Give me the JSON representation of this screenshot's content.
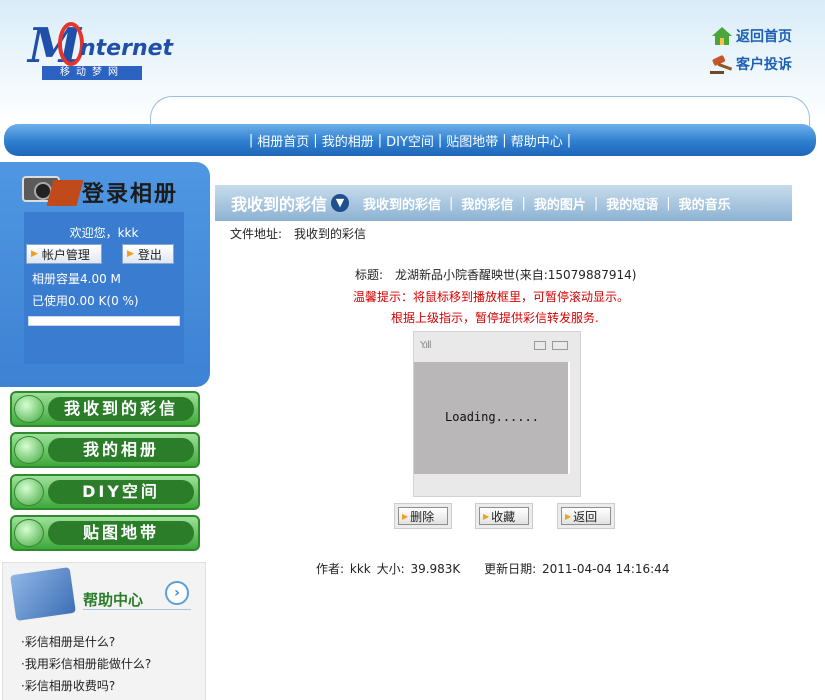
{
  "header": {
    "logo": {
      "mark": "M",
      "text": "nternet",
      "subtitle": "移动梦网"
    },
    "links": [
      {
        "label": "返回首页",
        "icon": "home-icon"
      },
      {
        "label": "客户投诉",
        "icon": "gavel-icon"
      }
    ]
  },
  "nav": {
    "items": [
      "相册首页",
      "我的相册",
      "DIY空间",
      "贴图地带",
      "帮助中心"
    ]
  },
  "login": {
    "title": "登录相册",
    "welcome": "欢迎您，kkk",
    "account_label": "帐户管理",
    "logout_label": "登出",
    "capacity": "相册容量4.00 M",
    "used": "已使用0.00 K(0 %)",
    "usage_fraction": 0.0
  },
  "menu": [
    {
      "label": "我收到的彩信",
      "icon": "globe-icon"
    },
    {
      "label": "我的相册",
      "icon": "heart-icon"
    },
    {
      "label": "DIY空间",
      "icon": "gear-icon"
    },
    {
      "label": "贴图地带",
      "icon": "refresh-icon"
    }
  ],
  "help": {
    "title": "帮助中心",
    "items": [
      "·彩信相册是什么?",
      "·我用彩信相册能做什么?",
      "·彩信相册收费吗?"
    ]
  },
  "tabs": {
    "current": "我收到的彩信",
    "items": [
      "我收到的彩信",
      "我的彩信",
      "我的图片",
      "我的短语",
      "我的音乐"
    ]
  },
  "file_path": {
    "label": "文件地址:",
    "value": "我收到的彩信"
  },
  "message": {
    "title_label": "标题:",
    "title_value": "龙湖新品小院香醒映世(来自:15079887914)",
    "tip1": "温馨提示：将鼠标移到播放框里，可暂停滚动显示。",
    "tip2": "根据上级指示，暂停提供彩信转发服务.",
    "loading": "Loading......"
  },
  "actions": {
    "delete": "删除",
    "collect": "收藏",
    "back": "返回"
  },
  "meta": {
    "author_label": "作者:",
    "author": "kkk",
    "size_label": "大小:",
    "size": "39.983K",
    "date_label": "更新日期:",
    "date": "2011-04-04 14:16:44"
  },
  "colors": {
    "nav_blue": "#2f7fd0",
    "menu_green": "#3ea83a",
    "tip_red": "#d40000"
  }
}
